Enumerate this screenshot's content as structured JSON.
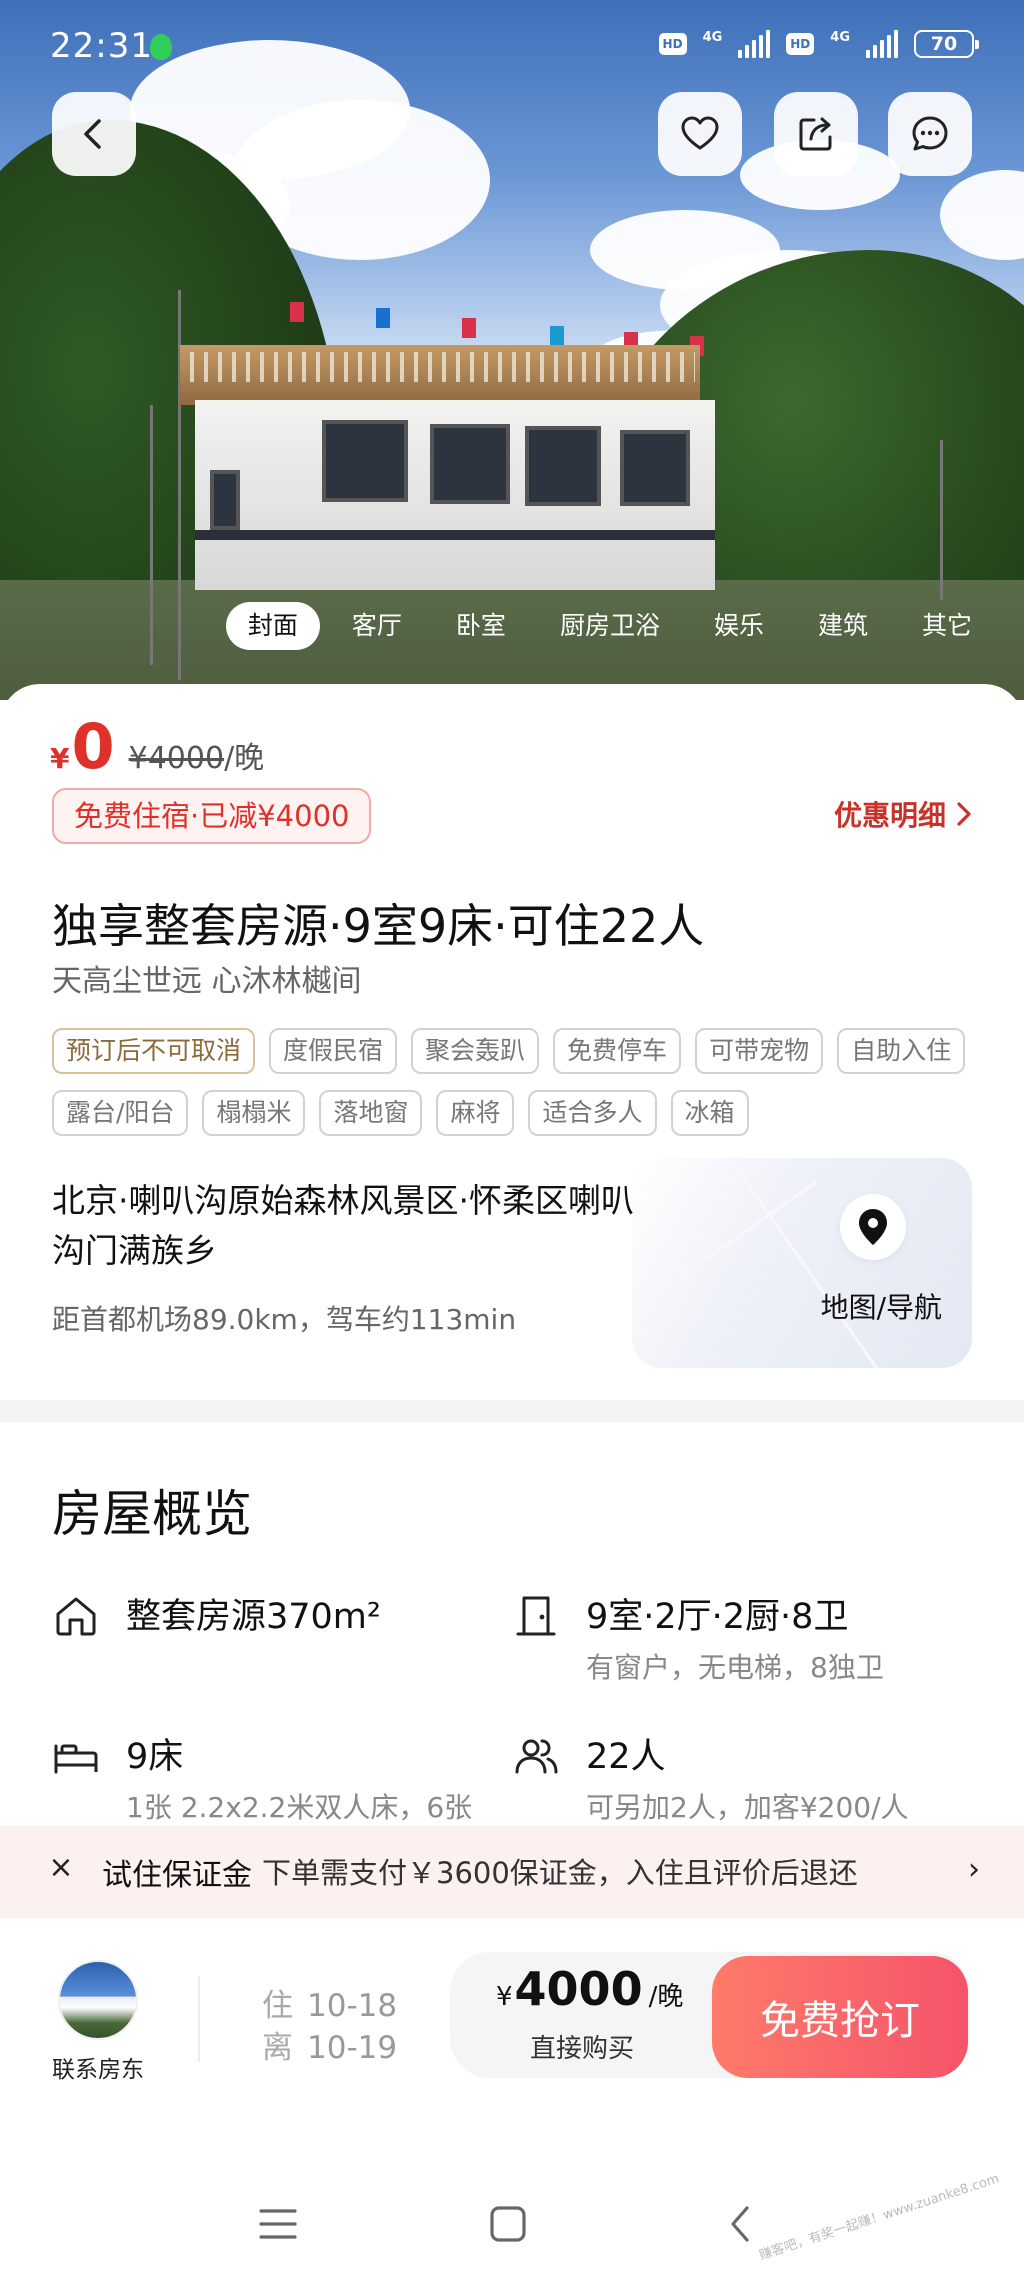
{
  "status_bar": {
    "time": "22:31",
    "hd1": "HD",
    "net1": "4G",
    "hd2": "HD",
    "net2": "4G",
    "battery": "70"
  },
  "header": {
    "back_icon": "chevron-left-icon",
    "favorite_icon": "heart-icon",
    "share_icon": "share-icon",
    "message_icon": "chat-icon"
  },
  "photo_tabs": [
    "封面",
    "客厅",
    "卧室",
    "厨房卫浴",
    "娱乐",
    "建筑",
    "其它"
  ],
  "price": {
    "currency": "¥",
    "current": "0",
    "original": "¥4000",
    "unit": "/晚",
    "promo_tag": "免费住宿·已减¥4000",
    "promo_detail": "优惠明细"
  },
  "listing": {
    "title": "独享整套房源·9室9床·可住22人",
    "subtitle": "天高尘世远   心沐林樾间",
    "tags": [
      {
        "text": "预订后不可取消",
        "style": "gold"
      },
      {
        "text": "度假民宿",
        "style": "plain"
      },
      {
        "text": "聚会轰趴",
        "style": "plain"
      },
      {
        "text": "免费停车",
        "style": "plain"
      },
      {
        "text": "可带宠物",
        "style": "plain"
      },
      {
        "text": "自助入住",
        "style": "plain"
      },
      {
        "text": "露台/阳台",
        "style": "plain"
      },
      {
        "text": "榻榻米",
        "style": "plain"
      },
      {
        "text": "落地窗",
        "style": "plain"
      },
      {
        "text": "麻将",
        "style": "plain"
      },
      {
        "text": "适合多人",
        "style": "plain"
      },
      {
        "text": "冰箱",
        "style": "plain"
      }
    ]
  },
  "location": {
    "address": "北京·喇叭沟原始森林风景区·怀柔区喇叭沟门满族乡",
    "distance": "距首都机场89.0km，驾车约113min",
    "map_label": "地图/导航"
  },
  "overview": {
    "title": "房屋概览",
    "items": [
      {
        "icon": "house-icon",
        "main": "整套房源370m²",
        "sub": ""
      },
      {
        "icon": "door-icon",
        "main": "9室·2厅·2厨·8卫",
        "sub": "有窗户，无电梯，8独卫"
      },
      {
        "icon": "bed-icon",
        "main": "9床",
        "sub": "1张 2.2x2.2米双人床，6张"
      },
      {
        "icon": "people-icon",
        "main": "22人",
        "sub": "可另加2人，加客¥200/人"
      }
    ]
  },
  "deposit": {
    "label": "试住保证金",
    "text": "下单需支付￥3600保证金，入住且评价后退还"
  },
  "action_bar": {
    "host_label": "联系房东",
    "checkin_key": "住",
    "checkin_date": "10-18",
    "checkout_key": "离",
    "checkout_date": "10-19",
    "buy_currency": "¥",
    "buy_price": "4000",
    "buy_unit": "/晚",
    "buy_sub": "直接购买",
    "cta": "免费抢订"
  },
  "navbar": {
    "menu_icon": "menu-icon",
    "home_icon": "home-square-icon",
    "back_icon": "back-arrow-icon"
  },
  "watermark": "赚客吧，有奖一起赚！www.zuanke8.com"
}
